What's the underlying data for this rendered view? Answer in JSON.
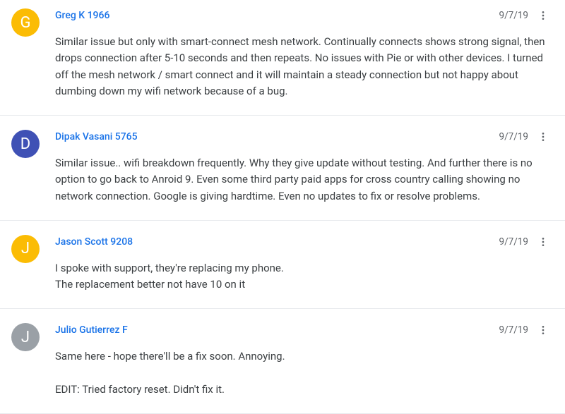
{
  "comments": [
    {
      "initial": "G",
      "avatar_color": "#fbbc04",
      "author": "Greg K 1966",
      "date": "9/7/19",
      "text": "Similar issue but only with smart-connect mesh network.  Continually connects shows strong signal, then drops connection after 5-10 seconds and then repeats. No issues with Pie or with other devices. I turned off the mesh network / smart connect and it will maintain a steady connection but not happy about dumbing down my wifi network because of a bug."
    },
    {
      "initial": "D",
      "avatar_color": "#3f51b5",
      "author": "Dipak Vasani 5765",
      "date": "9/7/19",
      "text": "Similar issue.. wifi breakdown frequently. Why they give update without testing. And further there is no option to go back to Anroid 9. Even some third party paid apps for cross country calling showing no network connection. Google is giving hardtime. Even no updates to fix or resolve problems."
    },
    {
      "initial": "J",
      "avatar_color": "#fbbc04",
      "author": "Jason Scott 9208",
      "date": "9/7/19",
      "text": "I spoke with support, they're replacing my phone.\nThe replacement better not have 10 on it"
    },
    {
      "initial": "J",
      "avatar_color": "#9aa0a6",
      "author": "Julio Gutierrez F",
      "date": "9/7/19",
      "text": "Same here - hope there'll be a fix soon. Annoying.\n\nEDIT: Tried factory reset. Didn't fix it."
    }
  ]
}
